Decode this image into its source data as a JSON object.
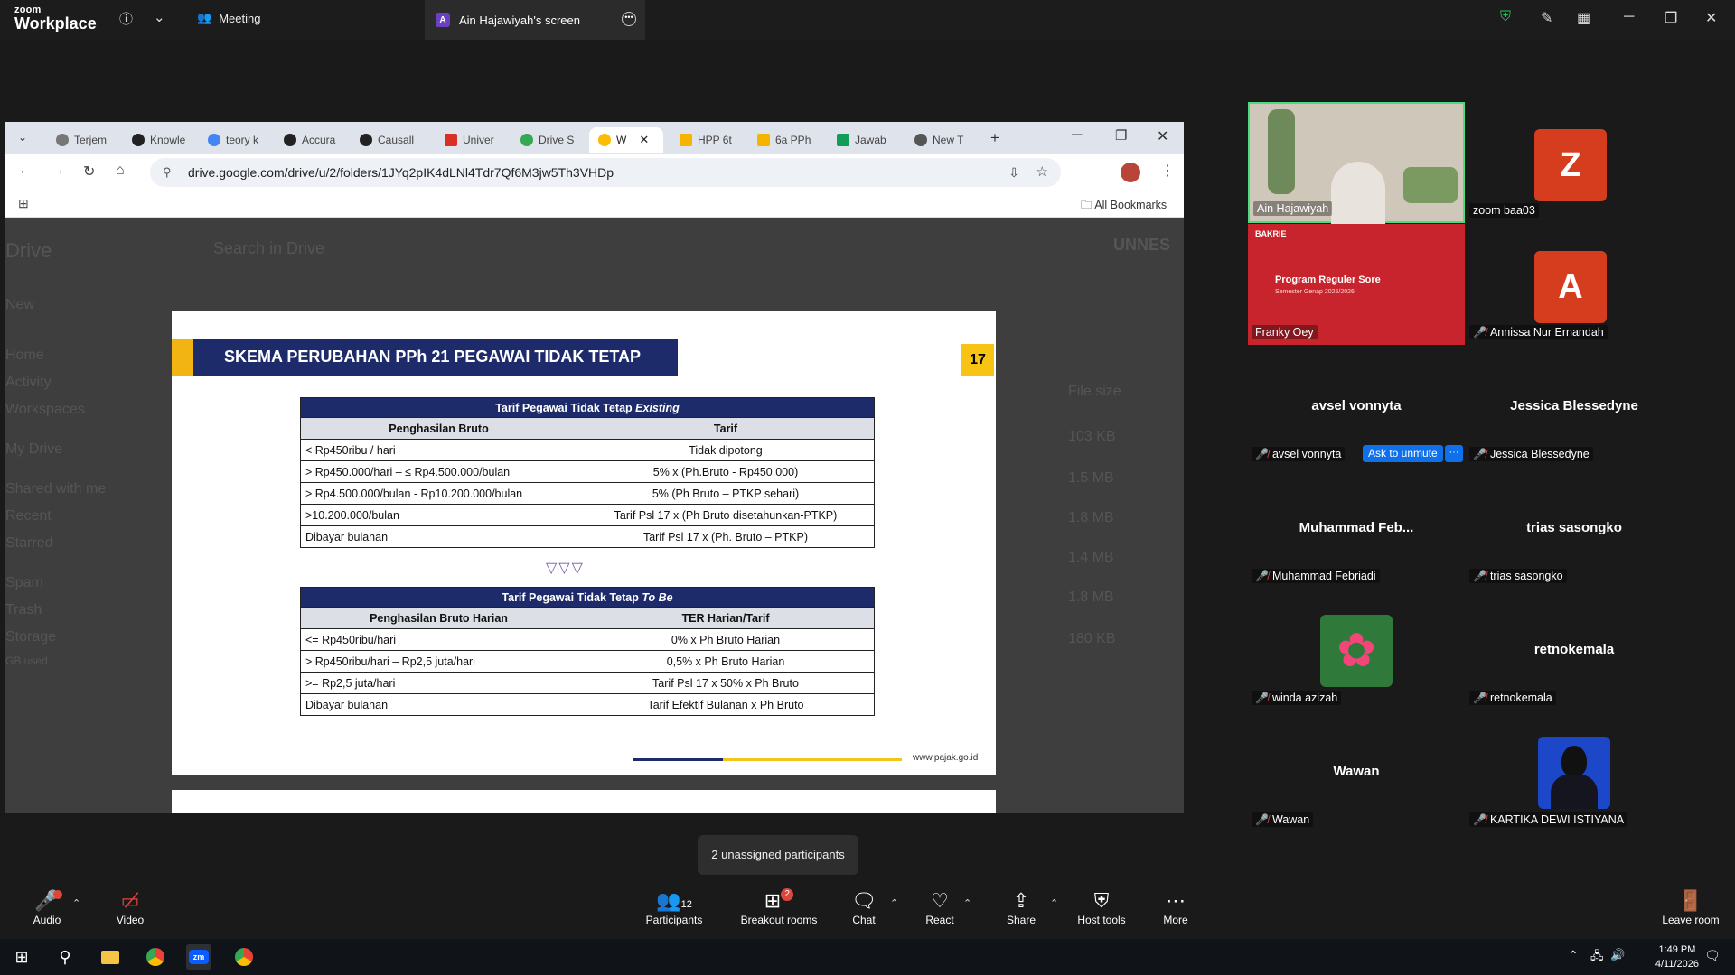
{
  "zoom": {
    "logo_line1": "zoom",
    "logo_line2": "Workplace",
    "meeting_tab": "Meeting",
    "screen_tab": "Ain Hajawiyah's screen",
    "screen_badge": "A"
  },
  "chrome": {
    "tabs": [
      "Terjem",
      "Knowle",
      "teory k",
      "Accura",
      "Causall",
      "Univer",
      "Drive S",
      "W",
      "HPP 6t",
      "6a PPh",
      "Jawab",
      "New T"
    ],
    "url": "drive.google.com/drive/u/2/folders/1JYq2pIK4dLNl4Tdr7Qf6M3jw5Th3VHDp",
    "all_bookmarks": "All Bookmarks"
  },
  "drive": {
    "brand": "Drive",
    "search_placeholder": "Search in Drive",
    "sidebar": [
      "New",
      "Home",
      "Activity",
      "Workspaces",
      "My Drive",
      "Shared with me",
      "Recent",
      "Starred",
      "Spam",
      "Trash",
      "Storage",
      "GB used"
    ],
    "col_file_size": "File size",
    "sizes": [
      "103 KB",
      "1.5 MB",
      "1.8 MB",
      "1.4 MB",
      "1.8 MB",
      "180 KB"
    ],
    "org": "UNNES"
  },
  "slide": {
    "title": "SKEMA PERUBAHAN PPh 21 PEGAWAI TIDAK TETAP",
    "page_number": "17",
    "table1_caption": "Tarif Pegawai Tidak Tetap",
    "table1_caption_em": "Existing",
    "table1_headers": [
      "Penghasilan Bruto",
      "Tarif"
    ],
    "table1_rows": [
      [
        "< Rp450ribu / hari",
        "Tidak dipotong"
      ],
      [
        "> Rp450.000/hari – ≤ Rp4.500.000/bulan",
        "5% x (Ph.Bruto - Rp450.000)"
      ],
      [
        "> Rp4.500.000/bulan - Rp10.200.000/bulan",
        "5% (Ph Bruto – PTKP sehari)"
      ],
      [
        ">10.200.000/bulan",
        "Tarif Psl 17 x (Ph Bruto disetahunkan-PTKP)"
      ],
      [
        "Dibayar bulanan",
        "Tarif Psl 17 x (Ph. Bruto – PTKP)"
      ]
    ],
    "table2_caption": "Tarif Pegawai Tidak Tetap",
    "table2_caption_em": "To Be",
    "table2_headers": [
      "Penghasilan Bruto Harian",
      "TER Harian/Tarif"
    ],
    "table2_rows": [
      [
        "<= Rp450ribu/hari",
        "0% x Ph Bruto Harian"
      ],
      [
        "> Rp450ribu/hari – Rp2,5 juta/hari",
        "0,5% x Ph Bruto Harian"
      ],
      [
        ">= Rp2,5 juta/hari",
        "Tarif Psl 17 x 50% x Ph Bruto"
      ],
      [
        "Dibayar bulanan",
        "Tarif Efektif Bulanan x Ph Bruto"
      ]
    ],
    "footer_url": "www.pajak.go.id"
  },
  "participants": [
    {
      "name": "Ain Hajawiyah",
      "type": "video"
    },
    {
      "name": "zoom baa03",
      "type": "avatar",
      "initial": "Z",
      "color": "#d63d1f"
    },
    {
      "name": "Franky Oey",
      "type": "video",
      "slide_title": "Program Reguler Sore",
      "slide_sub": "Semester Genap 2025/2026",
      "org": "BAKRIE"
    },
    {
      "name": "Annissa Nur Ernandah",
      "type": "avatar",
      "initial": "A",
      "color": "#d63d1f"
    },
    {
      "name": "avsel vonnyta",
      "display": "avsel vonnyta"
    },
    {
      "name": "Jessica Blessedyne",
      "display": "Jessica Blessedyne"
    },
    {
      "name": "Muhammad Febriadi",
      "display": "Muhammad  Feb..."
    },
    {
      "name": "trias sasongko",
      "display": "trias sasongko"
    },
    {
      "name": "winda azizah",
      "type": "photo"
    },
    {
      "name": "retnokemala",
      "display": "retnokemala"
    },
    {
      "name": "Wawan",
      "display": "Wawan"
    },
    {
      "name": "KARTIKA DEWI ISTIYANA",
      "type": "photo"
    }
  ],
  "ask_to_unmute": "Ask to unmute",
  "tooltip": "2 unassigned participants",
  "controls": {
    "audio": "Audio",
    "video": "Video",
    "participants": "Participants",
    "participants_count": "12",
    "breakout": "Breakout rooms",
    "breakout_badge": "2",
    "chat": "Chat",
    "react": "React",
    "share": "Share",
    "host_tools": "Host tools",
    "more": "More",
    "leave": "Leave room"
  },
  "taskbar": {
    "time": "1:49 PM",
    "date": "4/11/2026"
  },
  "colors": {
    "slide_navy": "#1e2b6b",
    "slide_yellow": "#f2b413",
    "zoom_red": "#e0453c",
    "active_speaker": "#4ade80"
  }
}
